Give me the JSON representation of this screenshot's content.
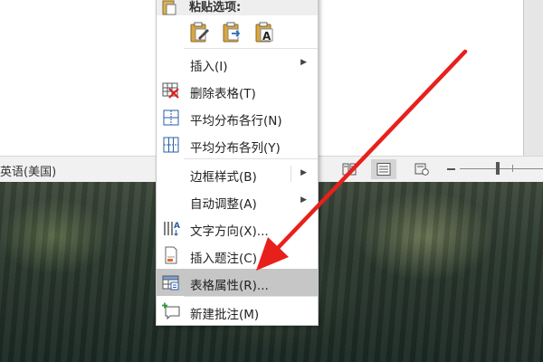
{
  "statusbar": {
    "language": "英语(美国)"
  },
  "context_menu": {
    "paste_options_label": "粘贴选项:",
    "paste_options": [
      {
        "icon": "paste-keep-source-formatting-icon"
      },
      {
        "icon": "paste-merge-formatting-icon"
      },
      {
        "icon": "paste-keep-text-only-icon"
      }
    ],
    "items": [
      {
        "label": "插入(I)",
        "submenu": true
      },
      {
        "label": "删除表格(T)",
        "icon": "delete-table-icon"
      },
      {
        "label": "平均分布各行(N)",
        "icon": "distribute-rows-icon"
      },
      {
        "label": "平均分布各列(Y)",
        "icon": "distribute-columns-icon"
      },
      {
        "label": "边框样式(B)",
        "submenu": true
      },
      {
        "label": "自动调整(A)",
        "submenu": true
      },
      {
        "label": "文字方向(X)...",
        "icon": "text-direction-icon"
      },
      {
        "label": "插入题注(C)",
        "icon": "insert-caption-icon"
      },
      {
        "label": "表格属性(R)...",
        "icon": "table-properties-icon",
        "highlighted": true
      },
      {
        "label": "新建批注(M)",
        "icon": "new-comment-icon"
      }
    ]
  },
  "colors": {
    "annotation_arrow": "#e8201c",
    "menu_highlight": "#c6c6c6"
  }
}
